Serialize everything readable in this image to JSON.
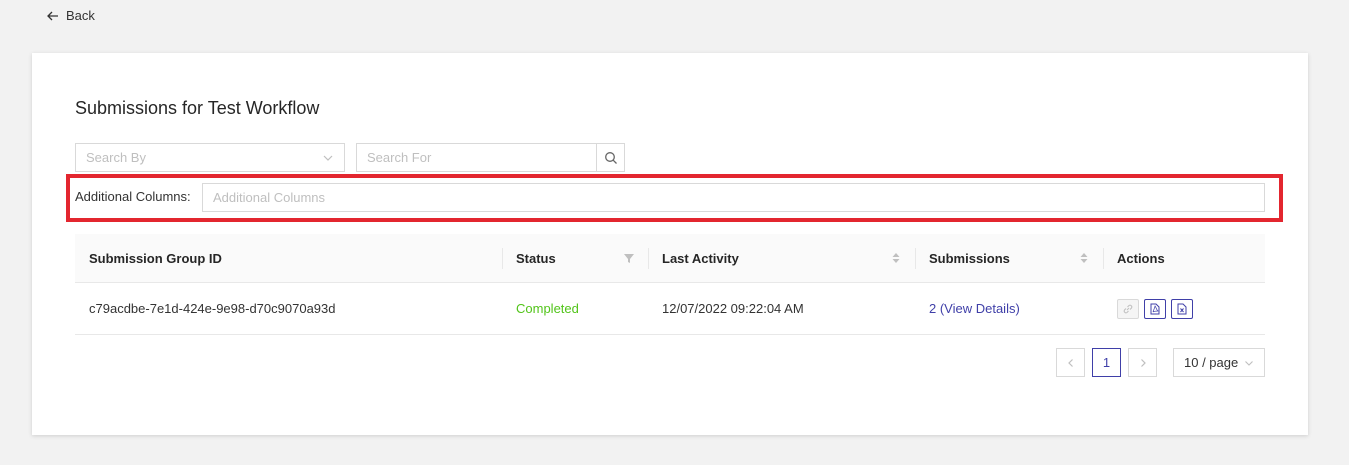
{
  "nav": {
    "back_label": "Back"
  },
  "page": {
    "title": "Submissions for Test Workflow"
  },
  "filters": {
    "search_by_placeholder": "Search By",
    "search_for_placeholder": "Search For",
    "additional_columns_label": "Additional Columns",
    "additional_columns_placeholder": "Additional Columns"
  },
  "table": {
    "columns": [
      "Submission Group ID",
      "Status",
      "Last Activity",
      "Submissions",
      "Actions"
    ],
    "rows": [
      {
        "id": "c79acdbe-7e1d-424e-9e98-d70c9070a93d",
        "status": "Completed",
        "last_activity": "12/07/2022 09:22:04 AM",
        "submissions": "2 (View Details)"
      }
    ]
  },
  "pagination": {
    "current_page": "1",
    "page_size": "10 / page"
  },
  "colors": {
    "accent": "#3f3fa8",
    "success": "#52c41a",
    "highlight": "#e3262f"
  }
}
